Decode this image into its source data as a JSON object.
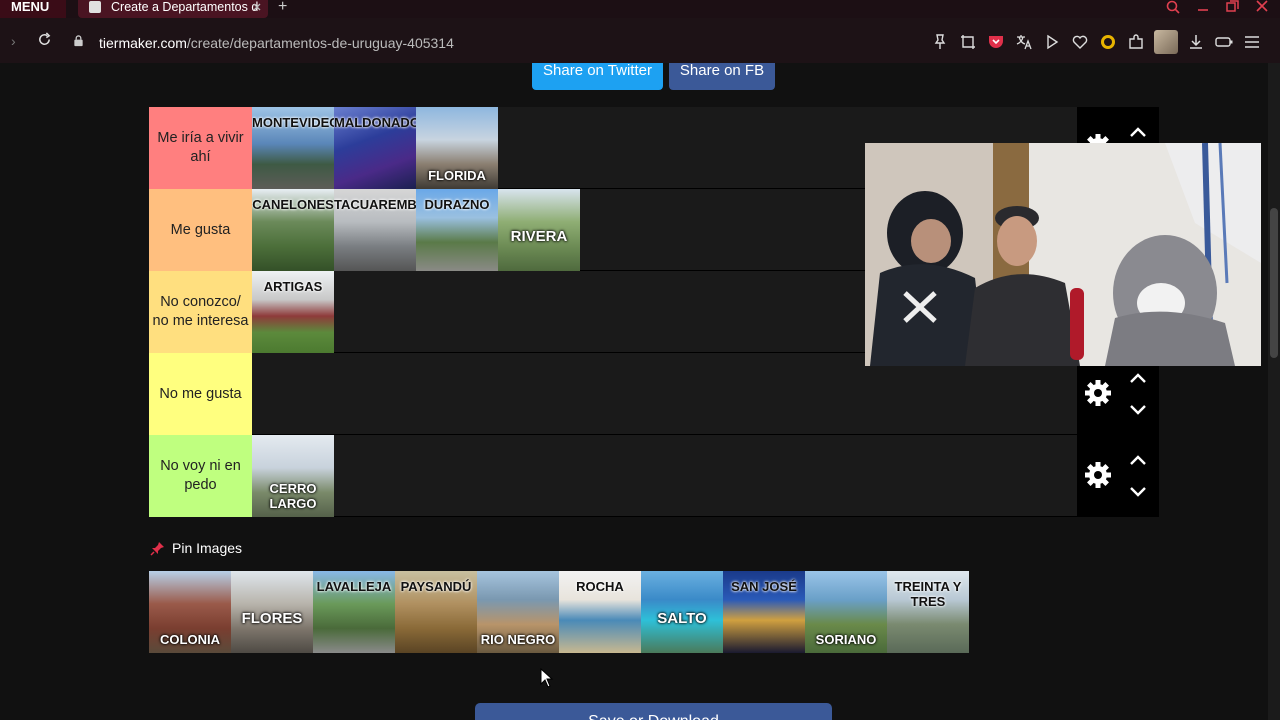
{
  "browser": {
    "menu_label": "MENU",
    "tab_title": "Create a Departamentos d",
    "url_host": "tiermaker.com",
    "url_path": "/create/departamentos-de-uruguay-405314"
  },
  "share": {
    "twitter": "Share on Twitter",
    "facebook": "Share on FB"
  },
  "tiers": [
    {
      "label": "Me iría a vivir ahí",
      "color": "#ff7f7f",
      "items": [
        {
          "name": "MONTEVIDEO",
          "pos": "top",
          "bg": "linear-gradient(180deg,#9ec4e6 0%,#5a86b8 45%,#3e5a44 70%,#5d5c58 100%)"
        },
        {
          "name": "MALDONADO",
          "pos": "top",
          "bg": "linear-gradient(160deg,#6a7fd0 0%,#2c3d9a 40%,#4a2a88 70%,#1a2050 100%)"
        },
        {
          "name": "FLORIDA",
          "pos": "bot",
          "bg": "linear-gradient(180deg,#8eb7df 0%,#c8d4e0 40%,#8a7e70 70%,#3e3a34 100%)"
        }
      ]
    },
    {
      "label": "Me gusta",
      "color": "#ffbf7f",
      "items": [
        {
          "name": "CANELONES",
          "pos": "top",
          "bg": "linear-gradient(180deg,#e8eef4 0%,#6b8a5a 40%,#4c6f3a 70%,#345028 100%)"
        },
        {
          "name": "TACUAREMBO",
          "pos": "top",
          "bg": "linear-gradient(180deg,#d6d6d6 0%,#b8bcc0 40%,#7a7e82 70%,#555 100%)"
        },
        {
          "name": "DURAZNO",
          "pos": "top",
          "bg": "linear-gradient(180deg,#6aa8e8 0%,#9ac0e0 35%,#5a7a48 65%,#8a8a86 100%)"
        },
        {
          "name": "RIVERA",
          "pos": "mid",
          "bg": "linear-gradient(180deg,#d8e4ee 0%,#8fae74 40%,#6d8c55 70%,#4f6a3e 100%)"
        }
      ]
    },
    {
      "label": "No conozco/ no me interesa",
      "color": "#ffdf7f",
      "items": [
        {
          "name": "ARTIGAS",
          "pos": "top",
          "bg": "linear-gradient(180deg,#eef2f4 0%,#c8c8c8 35%,#8e3a3a 55%,#5c8a3c 75%,#4c7a30 100%)"
        }
      ]
    },
    {
      "label": "No me gusta",
      "color": "#ffff7f",
      "items": []
    },
    {
      "label": "No voy ni en pedo",
      "color": "#bfff7f",
      "items": [
        {
          "name": "CERRO LARGO",
          "pos": "bot",
          "bg": "linear-gradient(180deg,#e4eaf0 0%,#c8d2dc 40%,#7a8a6a 70%,#55614a 100%)"
        }
      ]
    }
  ],
  "pin_label": "Pin Images",
  "pool": [
    {
      "name": "COLONIA",
      "pos": "bot",
      "bg": "linear-gradient(180deg,#b8d0e8 0%,#9a5a4a 40%,#7a3e30 70%,#5a4a3a 100%)"
    },
    {
      "name": "FLORES",
      "pos": "mid",
      "bg": "linear-gradient(180deg,#dfe6ec 0%,#b8b4ac 40%,#7e766c 70%,#4e4a44 100%)"
    },
    {
      "name": "LAVALLEJA",
      "pos": "top",
      "bg": "linear-gradient(180deg,#88b8e8 0%,#6a9a5a 40%,#4a6a3a 70%,#8a8a8a 100%)"
    },
    {
      "name": "PAYSANDÚ",
      "pos": "top",
      "bg": "linear-gradient(180deg,#c8c0a0 0%,#b09060 40%,#8a6a38 70%,#5a4424 100%)"
    },
    {
      "name": "RIO NEGRO",
      "pos": "bot",
      "bg": "linear-gradient(180deg,#a6c4de 0%,#7a98b0 35%,#b8946a 65%,#6a5a40 100%)"
    },
    {
      "name": "ROCHA",
      "pos": "top",
      "bg": "linear-gradient(180deg,#f2f2f2 0%,#e8e4dc 35%,#4a8ab8 60%,#c8b890 100%)"
    },
    {
      "name": "SALTO",
      "pos": "mid",
      "bg": "linear-gradient(180deg,#6ab0e0 0%,#3a8ac8 35%,#2ec0d8 60%,#4a7a5a 100%)"
    },
    {
      "name": "SAN JOSÉ",
      "pos": "top",
      "bg": "linear-gradient(180deg,#1a3a8a 0%,#2a5ab8 35%,#d0a040 60%,#1a1a30 100%)"
    },
    {
      "name": "SORIANO",
      "pos": "bot",
      "bg": "linear-gradient(180deg,#9ac4e8 0%,#6aa0c8 35%,#6a8a4a 65%,#4a6a3a 100%)"
    },
    {
      "name": "TREINTA Y TRES",
      "pos": "top",
      "bg": "linear-gradient(180deg,#dfe8ee 0%,#b8c8d4 35%,#7a8a70 65%,#5a6a58 100%)"
    }
  ],
  "save_label": "Save or Download"
}
